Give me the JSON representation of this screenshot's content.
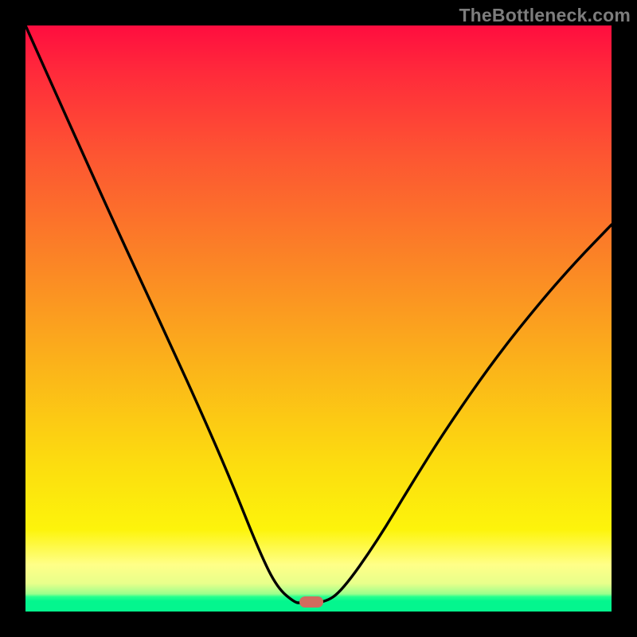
{
  "watermark": "TheBottleneck.com",
  "marker": {
    "cx": 0.488,
    "cy": 0.984
  },
  "chart_data": {
    "type": "line",
    "title": "",
    "xlabel": "",
    "ylabel": "",
    "xlim": [
      0,
      1
    ],
    "ylim": [
      0,
      1
    ],
    "series": [
      {
        "name": "bottleneck-curve",
        "x": [
          0.0,
          0.05,
          0.1,
          0.15,
          0.2,
          0.25,
          0.3,
          0.35,
          0.4,
          0.43,
          0.46,
          0.47,
          0.51,
          0.54,
          0.6,
          0.66,
          0.72,
          0.8,
          0.88,
          0.94,
          1.0
        ],
        "y": [
          1.0,
          0.888,
          0.777,
          0.666,
          0.558,
          0.45,
          0.34,
          0.225,
          0.1,
          0.04,
          0.015,
          0.015,
          0.015,
          0.035,
          0.12,
          0.22,
          0.315,
          0.43,
          0.53,
          0.598,
          0.66
        ]
      }
    ],
    "gradient_bands": [
      {
        "color": "#ff0d3f",
        "stop": 0.0
      },
      {
        "color": "#fd5532",
        "stop": 0.22
      },
      {
        "color": "#fbb31a",
        "stop": 0.58
      },
      {
        "color": "#fdf40b",
        "stop": 0.86
      },
      {
        "color": "#04f68e",
        "stop": 1.0
      }
    ]
  }
}
